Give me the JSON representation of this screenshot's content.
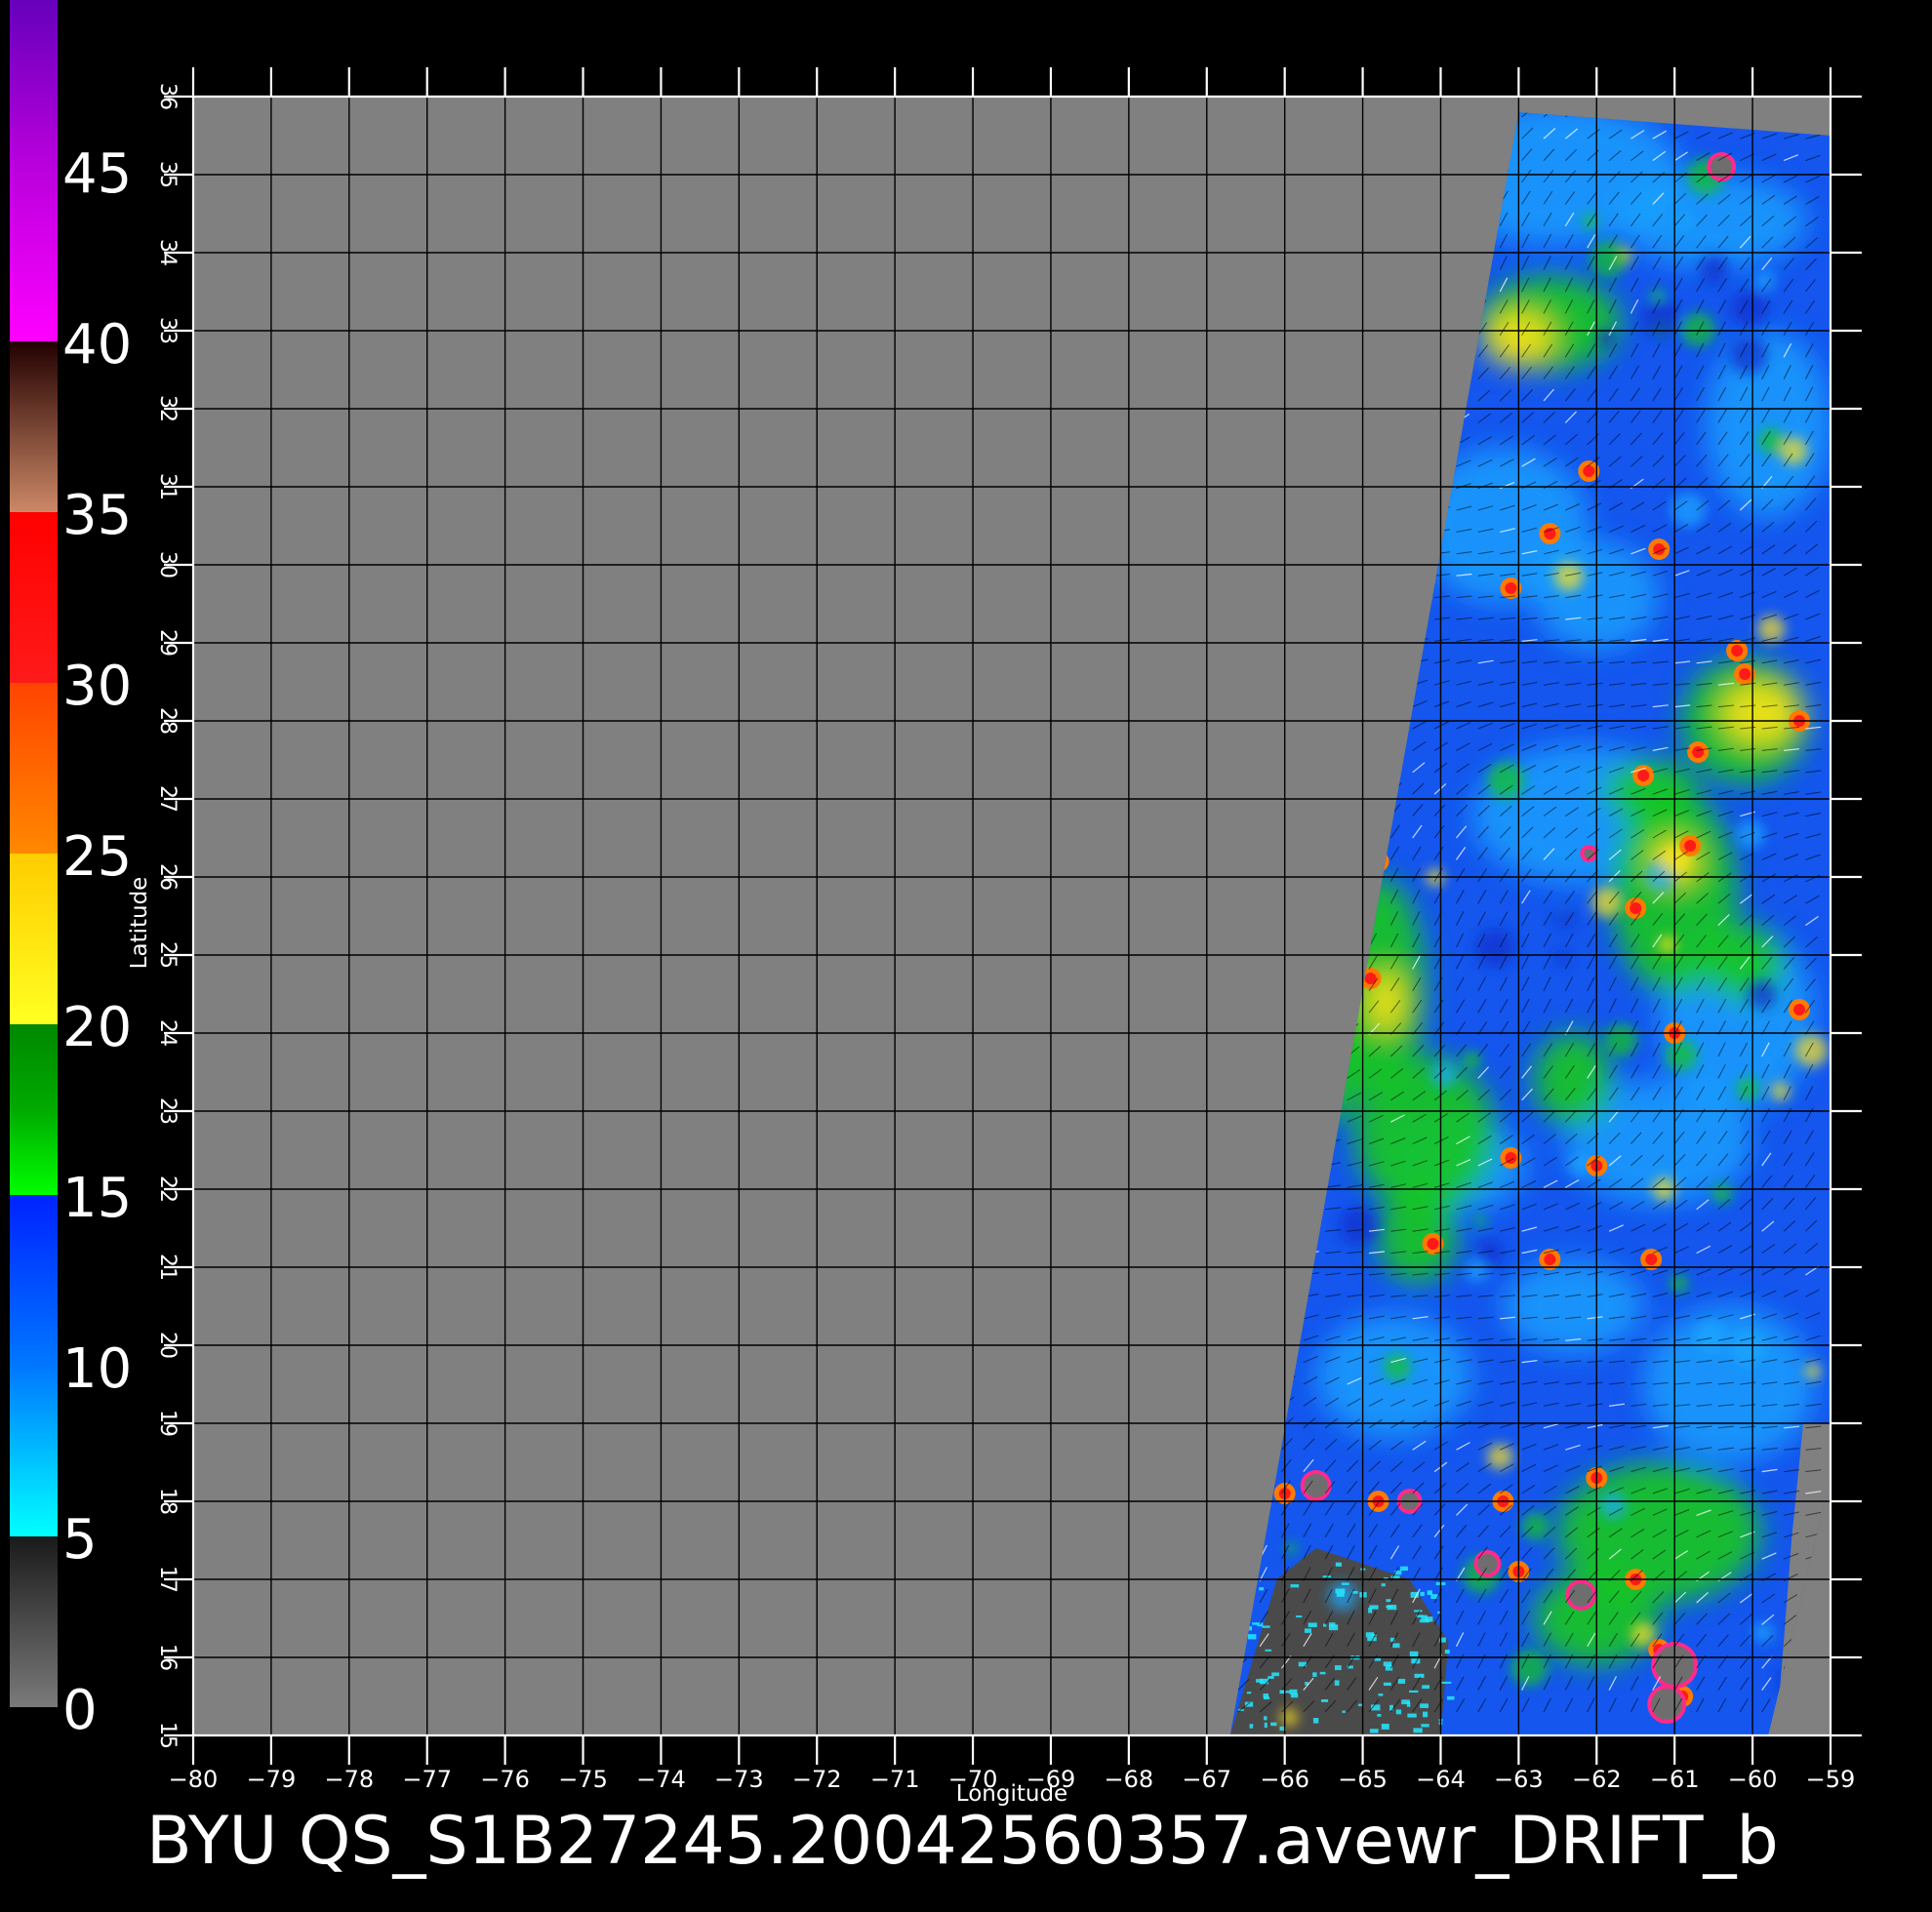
{
  "colorbar": {
    "labels": [
      "0",
      "5",
      "10",
      "15",
      "20",
      "25",
      "30",
      "35",
      "40",
      "45"
    ],
    "stops": [
      {
        "v": 0,
        "color": "#7a7a7a"
      },
      {
        "v": 5,
        "color": "#1a1a1a"
      },
      {
        "v": 5,
        "color": "#00ffff"
      },
      {
        "v": 10,
        "color": "#0077ff"
      },
      {
        "v": 15,
        "color": "#0022ff"
      },
      {
        "v": 15,
        "color": "#00ff00"
      },
      {
        "v": 17.5,
        "color": "#00aa00"
      },
      {
        "v": 20,
        "color": "#008800"
      },
      {
        "v": 20,
        "color": "#ffff22"
      },
      {
        "v": 25,
        "color": "#ffcc00"
      },
      {
        "v": 25,
        "color": "#ff8800"
      },
      {
        "v": 30,
        "color": "#ff4400"
      },
      {
        "v": 30,
        "color": "#ff1a1a"
      },
      {
        "v": 35,
        "color": "#ff0000"
      },
      {
        "v": 35,
        "color": "#cc8866"
      },
      {
        "v": 40,
        "color": "#220000"
      },
      {
        "v": 40,
        "color": "#ff00ff"
      },
      {
        "v": 45,
        "color": "#bb00dd"
      },
      {
        "v": 50,
        "color": "#6600bb"
      }
    ]
  },
  "map": {
    "lon_range": [
      -80,
      -59
    ],
    "lat_range": [
      15,
      36
    ],
    "x_ticks": [
      "-80",
      "-79",
      "-78",
      "-77",
      "-76",
      "-75",
      "-74",
      "-73",
      "-72",
      "-71",
      "-70",
      "-69",
      "-68",
      "-67",
      "-66",
      "-65",
      "-64",
      "-63",
      "-62",
      "-61",
      "-60",
      "-59"
    ],
    "y_ticks": [
      "15",
      "16",
      "17",
      "18",
      "19",
      "20",
      "21",
      "22",
      "23",
      "24",
      "25",
      "26",
      "27",
      "28",
      "29",
      "30",
      "31",
      "32",
      "33",
      "34",
      "35",
      "36"
    ],
    "xlabel": "Longitude",
    "ylabel": "Latitude",
    "swath_corners_lonlat": [
      [
        -63.0,
        35.8
      ],
      [
        -59.0,
        35.5
      ],
      [
        -59.0,
        18.3
      ],
      [
        -59.8,
        15.0
      ],
      [
        -66.7,
        15.0
      ]
    ],
    "background_color": "#808080",
    "grid_color": "#000000"
  },
  "caption": "BYU QS_S1B27245.20042560357.avewr_DRIFT_b"
}
